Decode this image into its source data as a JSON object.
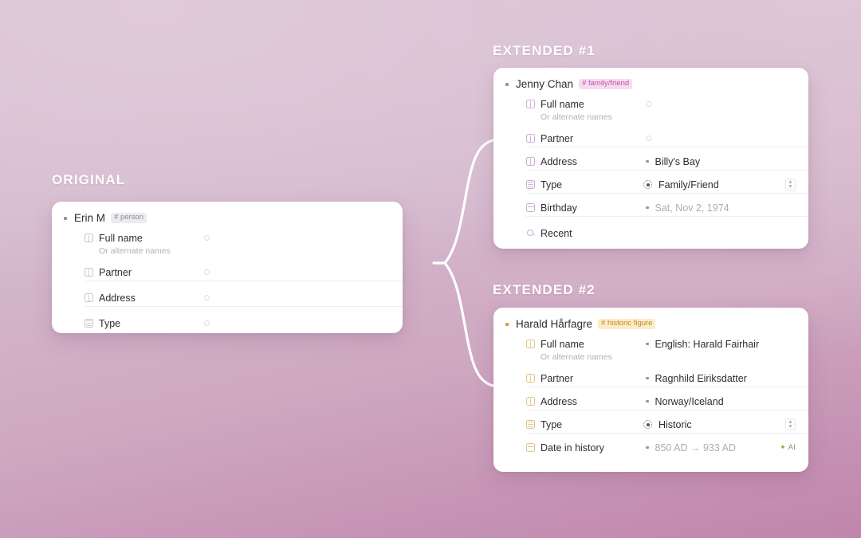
{
  "sections": {
    "original_label": "ORIGINAL",
    "ext1_label": "EXTENDED #1",
    "ext2_label": "EXTENDED #2"
  },
  "cards": {
    "original": {
      "title": "Erin M",
      "tag": "# person",
      "tag_style": "grey",
      "properties": [
        {
          "label": "Full name",
          "icon": "page-icon",
          "sublabel": "Or alternate names",
          "value": "",
          "value_state": "empty"
        },
        {
          "label": "Partner",
          "icon": "page-icon",
          "value": "",
          "value_state": "empty"
        },
        {
          "label": "Address",
          "icon": "page-icon",
          "value": "",
          "value_state": "empty"
        },
        {
          "label": "Type",
          "icon": "grid-icon",
          "value": "",
          "value_state": "empty"
        }
      ]
    },
    "ext1": {
      "title": "Jenny Chan",
      "tag": "# family/friend",
      "tag_style": "pink",
      "properties": [
        {
          "label": "Full name",
          "icon": "page-icon",
          "sublabel": "Or alternate names",
          "value": "",
          "value_state": "empty"
        },
        {
          "label": "Partner",
          "icon": "page-icon",
          "value": "",
          "value_state": "empty"
        },
        {
          "label": "Address",
          "icon": "page-icon",
          "value": "Billy's Bay",
          "value_state": "filled"
        },
        {
          "label": "Type",
          "icon": "grid-icon",
          "value": "Family/Friend",
          "value_state": "select",
          "stepper": "⌃⌄"
        },
        {
          "label": "Birthday",
          "icon": "calendar-icon",
          "value": "Sat, Nov 2, 1974",
          "value_state": "muted"
        },
        {
          "label": "Recent",
          "icon": "search-icon",
          "value": "",
          "value_state": "none"
        }
      ]
    },
    "ext2": {
      "title": "Harald Hårfagre",
      "tag": "# historic figure",
      "tag_style": "amber",
      "properties": [
        {
          "label": "Full name",
          "icon": "page-icon",
          "sublabel": "Or alternate names",
          "value": "English: Harald Fairhair",
          "value_state": "filled"
        },
        {
          "label": "Partner",
          "icon": "page-icon",
          "value": "Ragnhild Eiriksdatter",
          "value_state": "filled"
        },
        {
          "label": "Address",
          "icon": "page-icon",
          "value": "Norway/Iceland",
          "value_state": "filled"
        },
        {
          "label": "Type",
          "icon": "grid-icon",
          "value": "Historic",
          "value_state": "select",
          "stepper": "⌃⌄"
        },
        {
          "label": "Date in history",
          "icon": "calendar-icon",
          "value": "850 AD → 933 AD",
          "value_state": "muted",
          "badge": "AI",
          "badge_icon": "sparkle-icon"
        }
      ]
    }
  },
  "colors": {
    "tag_pink_bg": "#f6dcef",
    "tag_pink_fg": "#c150ab",
    "tag_amber_bg": "#fbecc9",
    "tag_amber_fg": "#c08a1e",
    "tag_grey_bg": "#ecebee",
    "tag_grey_fg": "#8e8a93",
    "ai_green": "#84a83c",
    "background_start": "#d9c4d6",
    "background_end": "#c085ab"
  }
}
